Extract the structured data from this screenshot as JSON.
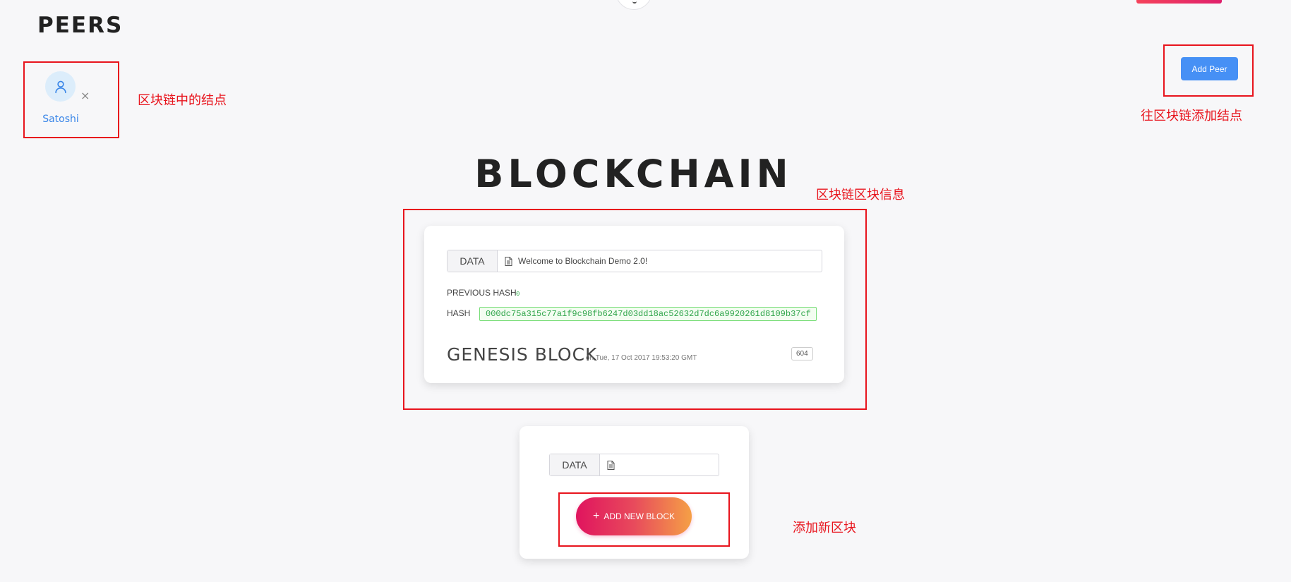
{
  "peers": {
    "title": "PEERS",
    "items": [
      {
        "name": "Satoshi",
        "remove_glyph": "×",
        "avatar_icon": "user-icon"
      }
    ],
    "add_button": "Add Peer"
  },
  "blockchain": {
    "title": "BLOCKCHAIN",
    "genesis": {
      "data_label": "DATA",
      "data_value": "Welcome to Blockchain Demo 2.0!",
      "prev_hash_label": "PREVIOUS HASH",
      "prev_hash_value": "0",
      "hash_label": "HASH",
      "hash_value": "000dc75a315c77a1f9c98fb6247d03dd18ac52632d7dc6a9920261d8109b37cf",
      "title": "GENESIS BLOCK",
      "date": "on Tue, 17 Oct 2017 19:53:20 GMT",
      "nonce": "604"
    },
    "new_block": {
      "data_label": "DATA",
      "data_value": "",
      "button_label": "ADD NEW BLOCK",
      "button_icon": "plus-icon"
    }
  },
  "annotations": {
    "peer_node": "区块链中的结点",
    "add_peer": "往区块链添加结点",
    "block_info": "区块链区块信息",
    "add_block": "添加新区块"
  },
  "colors": {
    "annotation_red": "#e8141d",
    "accent_blue": "#4690f5",
    "hash_green": "#2fa54a",
    "gradient_start": "#e0145e",
    "gradient_end": "#f5a046"
  }
}
